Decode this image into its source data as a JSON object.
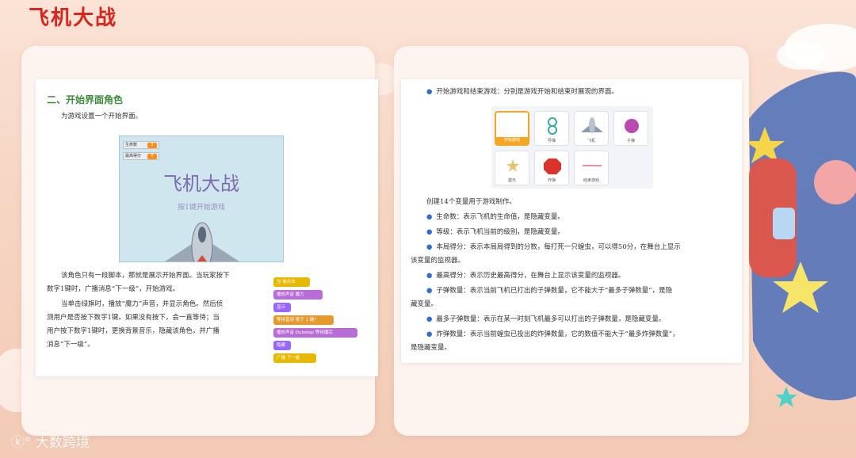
{
  "header": {
    "title": "飞机大战"
  },
  "left_page": {
    "heading": "二、开始界面角色",
    "intro": "为游戏设置一个开始界面。",
    "stage": {
      "variables": [
        {
          "label": "生命数",
          "value": "3"
        },
        {
          "label": "最高得分",
          "value": "0"
        }
      ],
      "title": "飞机大战",
      "subtitle": "按1键开始游戏"
    },
    "para1_line1": "该角色只有一段脚本，那就是展示开始界面。当玩家按下",
    "para1_line2": "数字1键时，广播消息“下一级”，开始游戏。",
    "para2_line1": "当单击绿旗时，播放“魔力”声音，并显示角色。然后侦",
    "para2_line2": "测用户是否按下数字1键。如果没有按下，会一直等待；当",
    "para2_line3": "用户按下数字1键时，更换背景音乐，隐藏该角色，并广播",
    "para2_line4": "消息“下一级”。",
    "blocks": [
      "当 被点击",
      "播放声音 魔力",
      "显示",
      "等待直到 按下 1 键?",
      "播放声音 Dubstep 等待播完",
      "隐藏",
      "广播 下一级"
    ]
  },
  "right_page": {
    "bullet_top": "开始游戏和结束游戏：分别是游戏开始和结束时展现的界面。",
    "sprites": [
      "开始游戏",
      "导弹",
      "飞机",
      "子弹",
      "激光",
      "炸弹",
      "结束游戏"
    ],
    "var_intro": "创建14个变量用于游戏制作。",
    "items": [
      "生命数：表示飞机的生命值，是隐藏变量。",
      "等级：表示飞机当前的级别，是隐藏变量。",
      "本局得分：表示本局局得到的分数，每打死一只蝗虫，可以得50分，在舞台上显示",
      "该变量的监视器。",
      "最高得分：表示历史最高得分，在舞台上显示该变量的监视器。",
      "子弹数量：表示当前飞机已打出的子弹数量，它不能大于“最多子弹数量”，是隐",
      "藏变量。",
      "最多子弹数量：表示在某一时刻飞机最多可以打出的子弹数量，是隐藏变量。",
      "炸弹数量：表示当前蝗虫已投出的炸弹数量，它的数值不能大于“最多炸弹数量”，",
      "是隐藏变量。"
    ]
  },
  "footer": {
    "watermark": "大数跨境"
  },
  "colors": {
    "title_red": "#d8261f",
    "heading_green": "#3b8a3a",
    "bullet_blue": "#2e6fcf"
  }
}
